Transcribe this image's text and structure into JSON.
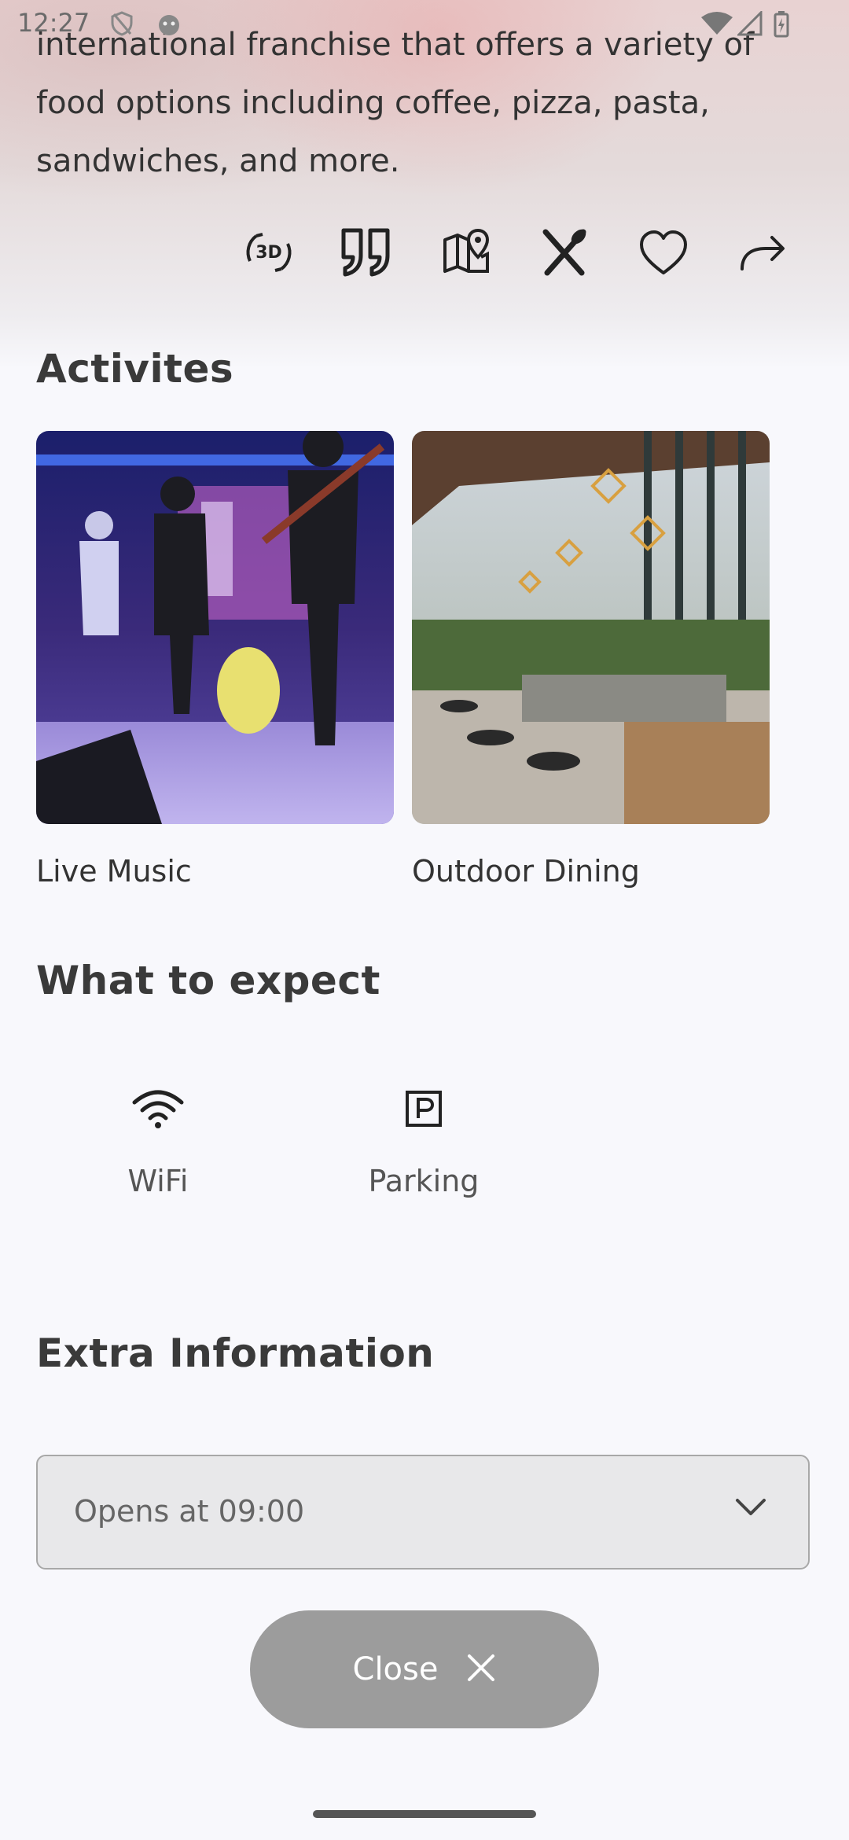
{
  "status_bar": {
    "time": "12:27",
    "icons": [
      "shield-icon",
      "android-icon",
      "wifi-signal-icon",
      "cell-signal-icon",
      "battery-icon"
    ]
  },
  "description": "international franchise that offers a variety of food options including coffee, pizza, pasta, sandwiches, and more.",
  "actions": [
    {
      "name": "3d-view-icon",
      "glyph": "3D"
    },
    {
      "name": "quote-icon"
    },
    {
      "name": "map-pin-icon"
    },
    {
      "name": "fork-knife-icon"
    },
    {
      "name": "heart-icon"
    },
    {
      "name": "share-icon"
    }
  ],
  "activities": {
    "title": "Activites",
    "items": [
      {
        "label": "Live Music"
      },
      {
        "label": "Outdoor Dining"
      }
    ]
  },
  "expect": {
    "title": "What to expect",
    "items": [
      {
        "label": "WiFi",
        "icon": "wifi-icon"
      },
      {
        "label": "Parking",
        "icon": "parking-icon"
      }
    ]
  },
  "extra": {
    "title": "Extra Information",
    "opening_hours": "Opens at 09:00"
  },
  "close_button": {
    "label": "Close"
  }
}
